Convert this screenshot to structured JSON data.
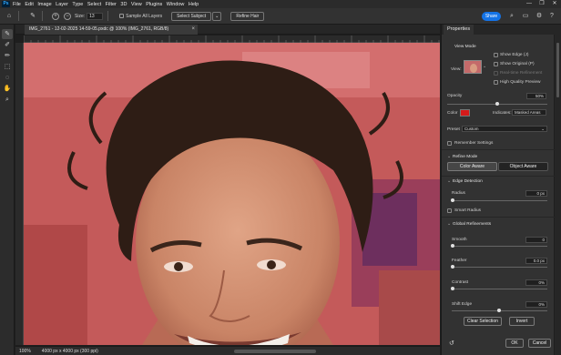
{
  "app": {
    "logo": "Ps",
    "menu": [
      "File",
      "Edit",
      "Image",
      "Layer",
      "Type",
      "Select",
      "Filter",
      "3D",
      "View",
      "Plugins",
      "Window",
      "Help"
    ],
    "window_controls": [
      "—",
      "❐",
      "✕"
    ]
  },
  "options": {
    "size_label": "Size:",
    "size_value": "13",
    "sample_all_layers": "Sample All Layers",
    "select_subject": "Select Subject",
    "refine_hair": "Refine Hair",
    "share": "Share"
  },
  "document": {
    "tab_title": "IMG_2761 - 12-02-2025 14-59-05.pxdc @ 100% (IMG_2761, RGB/8)",
    "zoom": "100%",
    "info": "4000 px x 4000 px (300 ppi)"
  },
  "properties": {
    "title": "Properties",
    "view_mode": "View Mode",
    "view_label": "View:",
    "show_edge": "Show Edge (J)",
    "show_original": "Show Original (P)",
    "real_time": "Real-time Refinement",
    "hq_preview": "High Quality Preview",
    "opacity_label": "Opacity",
    "opacity_value": "50%",
    "opacity_level": 0.5,
    "color_label": "Color",
    "color_value": "#d41a1a",
    "indicates_label": "Indicates:",
    "indicates_value": "Masked Areas",
    "preset_label": "Preset",
    "preset_value": "Custom",
    "remember": "Remember Settings",
    "refine_mode": "Refine Mode",
    "color_aware": "Color Aware",
    "object_aware": "Object Aware",
    "edge_detection": "Edge Detection",
    "radius_label": "Radius",
    "radius_value": "0 px",
    "smart_radius": "Smart Radius",
    "global_refinements": "Global Refinements",
    "smooth_label": "Smooth",
    "smooth_value": "0",
    "feather_label": "Feather",
    "feather_value": "0.0 px",
    "contrast_label": "Contrast",
    "contrast_value": "0%",
    "shift_edge_label": "Shift Edge",
    "shift_edge_value": "0%",
    "clear_selection": "Clear Selection",
    "invert": "Invert",
    "ok": "OK",
    "cancel": "Cancel"
  }
}
